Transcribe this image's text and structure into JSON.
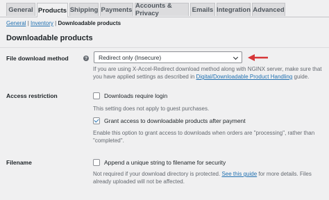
{
  "tabs": [
    {
      "label": "General"
    },
    {
      "label": "Products"
    },
    {
      "label": "Shipping"
    },
    {
      "label": "Payments"
    },
    {
      "label": "Accounts & Privacy"
    },
    {
      "label": "Emails"
    },
    {
      "label": "Integration"
    },
    {
      "label": "Advanced"
    }
  ],
  "subnav": {
    "general": "General",
    "sep1": " | ",
    "inventory": "Inventory",
    "sep2": " | ",
    "current": "Downloadable products"
  },
  "section_title": "Downloadable products",
  "file_download": {
    "label": "File download method",
    "help": "?",
    "selected": "Redirect only (Insecure)",
    "desc_pre": "If you are using X-Accel-Redirect download method along with NGINX server, make sure that you have applied settings as described in ",
    "desc_link": "Digital/Downloadable Product Handling",
    "desc_post": " guide."
  },
  "access": {
    "label": "Access restriction",
    "require_login": "Downloads require login",
    "require_login_desc": "This setting does not apply to guest purchases.",
    "grant_access": "Grant access to downloadable products after payment",
    "grant_access_desc": "Enable this option to grant access to downloads when orders are \"processing\", rather than \"completed\"."
  },
  "filename": {
    "label": "Filename",
    "append": "Append a unique string to filename for security",
    "desc_pre": "Not required if your download directory is protected. ",
    "desc_link": "See this guide",
    "desc_post": " for more details. Files already uploaded will not be affected."
  },
  "colors": {
    "accent": "#2271b1",
    "arrow": "#d63638"
  }
}
